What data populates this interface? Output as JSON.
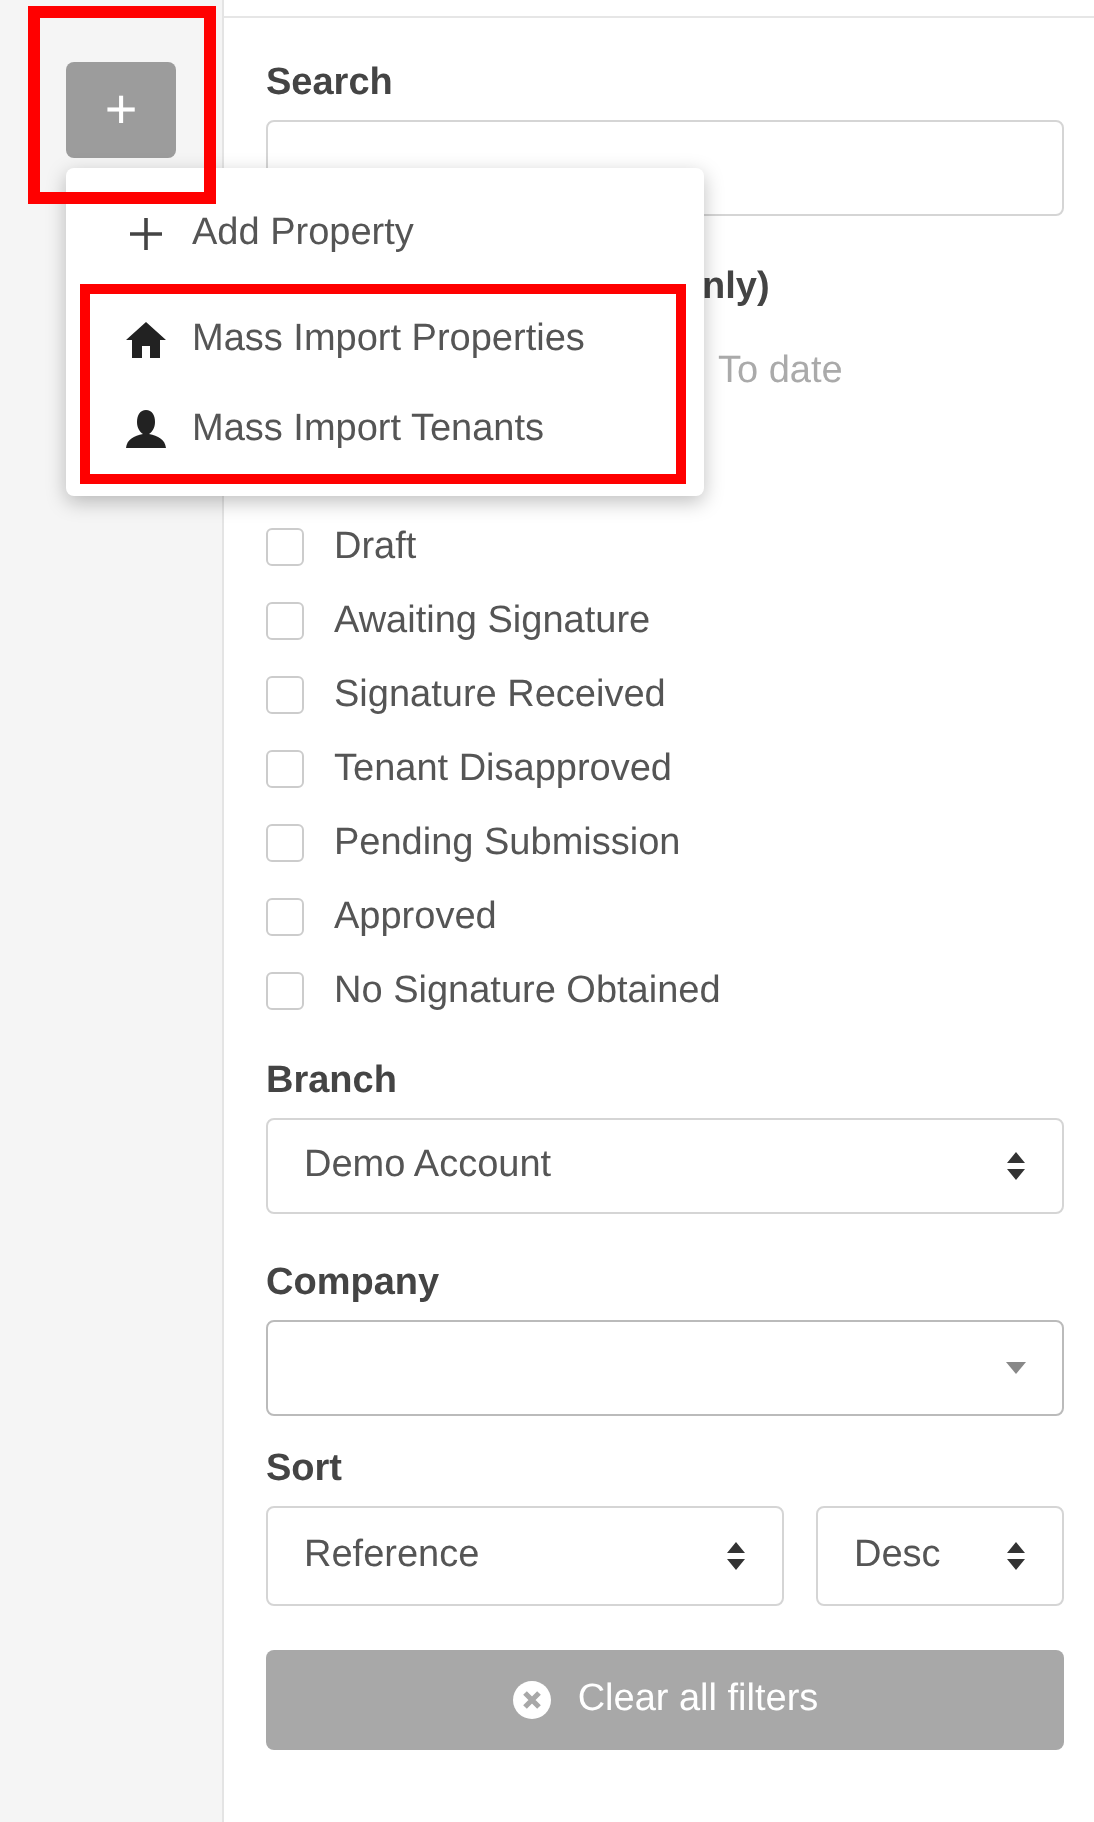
{
  "add_button": {
    "label": "+"
  },
  "add_menu": {
    "items": [
      {
        "kind": "plus",
        "label": "Add Property",
        "highlighted": false
      },
      {
        "kind": "house",
        "label": "Mass Import Properties",
        "highlighted": true
      },
      {
        "kind": "person",
        "label": "Mass Import Tenants",
        "highlighted": true
      }
    ]
  },
  "search": {
    "label": "Search"
  },
  "date_filter": {
    "label": "nly)",
    "to_placeholder": "To date"
  },
  "status_filter": {
    "options": [
      {
        "label": "Draft",
        "checked": false
      },
      {
        "label": "Awaiting Signature",
        "checked": false
      },
      {
        "label": "Signature Received",
        "checked": false
      },
      {
        "label": "Tenant Disapproved",
        "checked": false
      },
      {
        "label": "Pending Submission",
        "checked": false
      },
      {
        "label": "Approved",
        "checked": false
      },
      {
        "label": "No Signature Obtained",
        "checked": false
      }
    ]
  },
  "branch": {
    "label": "Branch",
    "value": "Demo Account",
    "kind": "native"
  },
  "company": {
    "label": "Company",
    "kind": "combo"
  },
  "sort": {
    "label": "Sort",
    "field": {
      "value": "Reference",
      "kind": "native"
    },
    "order": {
      "value": "Desc",
      "kind": "native"
    }
  },
  "clear_button": {
    "label": "Clear all filters"
  }
}
